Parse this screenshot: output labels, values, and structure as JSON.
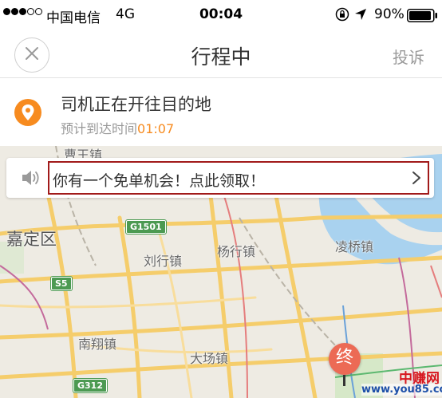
{
  "status_bar": {
    "carrier": "中国电信",
    "network": "4G",
    "time": "00:04",
    "battery": "90%"
  },
  "nav": {
    "title": "行程中",
    "complain_label": "投诉"
  },
  "trip": {
    "status": "司机正在开往目的地",
    "eta_label": "预计到达时间",
    "eta_time": "01:07",
    "accent_color": "#f78b1f"
  },
  "promo": {
    "text": "你有一个免单机会！点此领取！",
    "highlight_color": "#a11a1a"
  },
  "map": {
    "places": {
      "caowang": "曹王镇",
      "jiading": "嘉定区",
      "liuhang": "刘行镇",
      "yanghang": "杨行镇",
      "lingqiao": "凌桥镇",
      "nanxiang": "南翔镇",
      "dachang": "大场镇"
    },
    "roads": {
      "g1501": "G1501",
      "s5": "S5",
      "g312": "G312"
    },
    "destination_marker": "终"
  },
  "watermark": {
    "name": "中赚网",
    "url": "www.you85.com"
  }
}
